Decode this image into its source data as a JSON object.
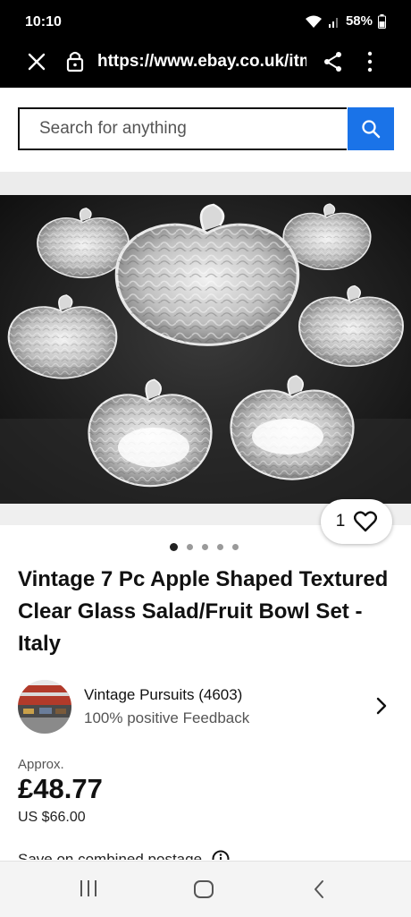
{
  "status_bar": {
    "time": "10:10",
    "battery": "58%",
    "icons": [
      "wifi-icon",
      "signal-icon",
      "battery-icon"
    ]
  },
  "browser": {
    "url": "https://www.ebay.co.uk/itm",
    "icons": [
      "close-icon",
      "lock-icon",
      "share-icon",
      "more-vertical-icon"
    ]
  },
  "search": {
    "placeholder": "Search for anything",
    "button_icon": "search-icon",
    "accent": "#1a73e8"
  },
  "gallery": {
    "image_name": "apple-glass-bowl-set-photo",
    "like_count": "1",
    "like_icon": "heart-outline-icon",
    "dots_total": 5,
    "dot_active": 1
  },
  "listing": {
    "title": "Vintage 7 Pc Apple Shaped Textured Clear Glass Salad/Fruit Bowl Set -Italy"
  },
  "seller": {
    "name": "Vintage Pursuits (4603)",
    "feedback": "100% positive Feedback",
    "avatar": "seller-storefront-avatar",
    "chevron_icon": "chevron-right-icon"
  },
  "price": {
    "approx_label": "Approx.",
    "amount": "£48.77",
    "usd": "US $66.00"
  },
  "postage": {
    "text": "Save on combined postage",
    "info_icon": "info-icon"
  },
  "android_nav": {
    "icons": [
      "recent-apps-icon",
      "home-icon",
      "back-icon"
    ]
  }
}
